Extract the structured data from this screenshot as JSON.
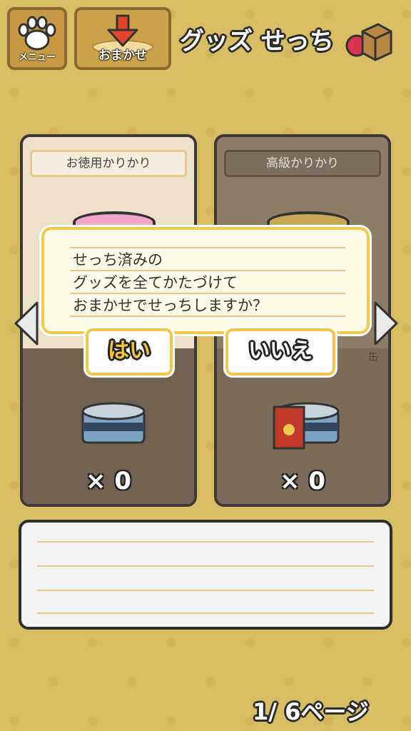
{
  "header": {
    "menu_label": "メニュー",
    "auto_label": "おまかせ",
    "title": "グッズ せっち"
  },
  "cards": [
    {
      "name": "お徳用かりかり",
      "count": "× 0"
    },
    {
      "name": "高級かりかり",
      "count": "× 0",
      "subtag": "缶"
    }
  ],
  "dialog": {
    "lines": [
      "せっち済みの",
      "グッズを全てかたづけて",
      "おまかせでせっちしますか？"
    ],
    "yes_label": "はい",
    "no_label": "いいえ"
  },
  "pager": {
    "text": "1/  6ページ"
  },
  "colors": {
    "accent": "#f2c84a",
    "background": "#d8bd63",
    "yes_text": "#f3c23c"
  }
}
